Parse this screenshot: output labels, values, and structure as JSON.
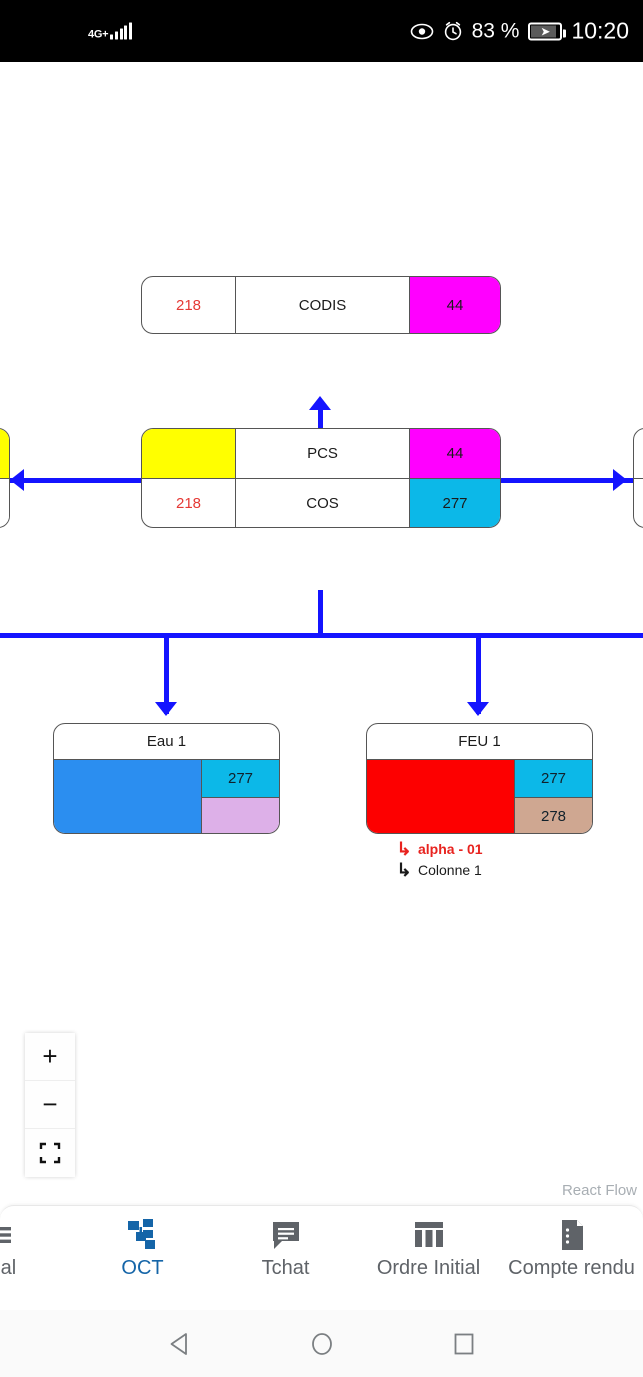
{
  "status_bar": {
    "network_label": "4G+",
    "signal_bars": 5,
    "eye_icon": "eye-icon",
    "alarm_icon": "alarm-icon",
    "battery_percent": "83 %",
    "battery_icon": "battery-charging-icon",
    "time": "10:20"
  },
  "canvas": {
    "attribution": "React Flow",
    "edge_color": "#1414ff",
    "zoom_controls": {
      "zoom_in": "+",
      "zoom_out": "−",
      "fit_view": "fit-view-icon"
    },
    "nodes": {
      "codis": {
        "left_value": "218",
        "title": "CODIS",
        "right_value": "44",
        "right_color": "#ff00ff",
        "left_color": "#e53935"
      },
      "pcs": {
        "row1": {
          "left_value": "",
          "left_color": "#ffff00",
          "title": "PCS",
          "right_value": "44",
          "right_color": "#ff00ff"
        },
        "row2": {
          "left_value": "218",
          "left_color": "#e53935",
          "title": "COS",
          "right_value": "277",
          "right_color": "#0cb8e8"
        }
      },
      "eau1": {
        "title": "Eau 1",
        "main_color": "#2b8ef0",
        "side": [
          {
            "value": "277",
            "color": "#0cb8e8"
          },
          {
            "value": "",
            "color": "#ddb0e8"
          }
        ]
      },
      "feu1": {
        "title": "FEU 1",
        "main_color": "#fd0000",
        "side": [
          {
            "value": "277",
            "color": "#0cb8e8"
          },
          {
            "value": "278",
            "color": "#cfa791"
          }
        ],
        "sublabels": [
          {
            "arrow": "arrow-branch-icon",
            "text": "alpha - 01",
            "color": "#e8231f"
          },
          {
            "arrow": "arrow-branch-icon",
            "text": "Colonne 1",
            "color": "#1b1b1b"
          }
        ]
      },
      "left_partial": {
        "top_color": "#ffff00",
        "bottom_color": "#ffffff"
      },
      "right_partial": {
        "color": "#ffffff"
      }
    }
  },
  "bottom_nav": {
    "items": [
      {
        "icon": "list-icon",
        "label": "rnal",
        "active": false
      },
      {
        "icon": "org-chart-icon",
        "label": "OCT",
        "active": true
      },
      {
        "icon": "chat-icon",
        "label": "Tchat",
        "active": false
      },
      {
        "icon": "columns-icon",
        "label": "Ordre Initial",
        "active": false
      },
      {
        "icon": "report-document-icon",
        "label": "Compte rendu",
        "active": false
      }
    ],
    "active_color": "#1565a8",
    "inactive_color": "#5f6368"
  },
  "system_nav": {
    "back": "back-triangle-icon",
    "home": "home-circle-icon",
    "recents": "recents-square-icon"
  }
}
